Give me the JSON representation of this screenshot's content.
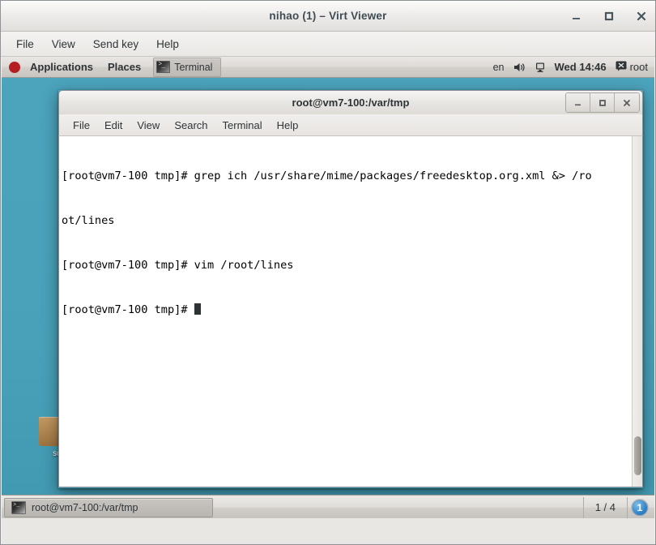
{
  "host_window": {
    "title": "nihao (1) – Virt Viewer",
    "menu": [
      "File",
      "View",
      "Send key",
      "Help"
    ],
    "controls": {
      "minimize": "minimize-icon",
      "maximize": "maximize-icon",
      "close": "close-icon"
    }
  },
  "guest_top_panel": {
    "logo_icon": "fedora-logo-icon",
    "applications_label": "Applications",
    "places_label": "Places",
    "window_button": {
      "icon": "terminal-icon",
      "label": "Terminal"
    },
    "tray": {
      "keyboard_layout": "en",
      "volume_icon": "volume-icon",
      "display_icon": "display-icon",
      "clock": "Wed 14:46",
      "user_icon": "user-status-icon",
      "user_label": "root"
    }
  },
  "desktop": {
    "icon_label": "sc",
    "background_color": "#4ba3bc"
  },
  "terminal_window": {
    "title": "root@vm7-100:/var/tmp",
    "menu": [
      "File",
      "Edit",
      "View",
      "Search",
      "Terminal",
      "Help"
    ],
    "controls": {
      "minimize": "minimize-icon",
      "maximize": "maximize-icon",
      "close": "close-icon"
    },
    "lines": [
      "[root@vm7-100 tmp]# grep ich /usr/share/mime/packages/freedesktop.org.xml &> /ro",
      "ot/lines",
      "[root@vm7-100 tmp]# vim /root/lines"
    ],
    "prompt": "[root@vm7-100 tmp]# ",
    "cursor": "block-cursor",
    "scrollbar": "vertical-scrollbar"
  },
  "guest_bottom_panel": {
    "task": {
      "icon": "terminal-icon",
      "label": "root@vm7-100:/var/tmp"
    },
    "pager_label": "1 / 4",
    "workspace_badge": "1"
  }
}
